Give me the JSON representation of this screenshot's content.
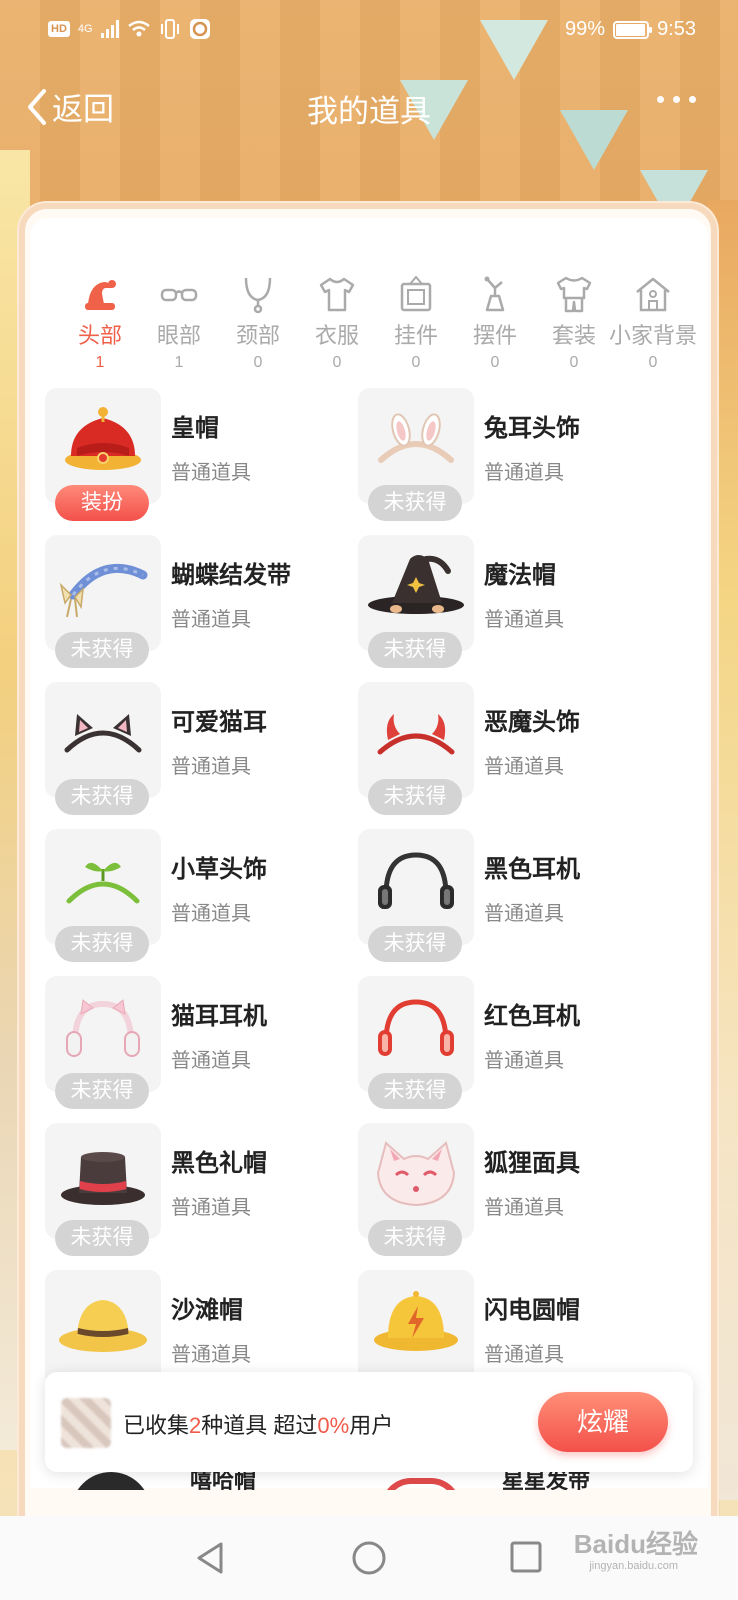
{
  "status_bar": {
    "hd": "HD",
    "network": "4G",
    "battery": "99%",
    "time": "9:53"
  },
  "nav": {
    "back_label": "返回",
    "title": "我的道具"
  },
  "tabs": [
    {
      "icon": "hat-icon",
      "label": "头部",
      "count": "1"
    },
    {
      "icon": "glasses-icon",
      "label": "眼部",
      "count": "1"
    },
    {
      "icon": "necklace-icon",
      "label": "颈部",
      "count": "0"
    },
    {
      "icon": "tshirt-icon",
      "label": "衣服",
      "count": "0"
    },
    {
      "icon": "frame-icon",
      "label": "挂件",
      "count": "0"
    },
    {
      "icon": "ornament-icon",
      "label": "摆件",
      "count": "0"
    },
    {
      "icon": "suit-icon",
      "label": "套装",
      "count": "0"
    },
    {
      "icon": "house-icon",
      "label": "小家背景",
      "count": "0"
    }
  ],
  "items": [
    {
      "name": "皇帽",
      "type": "普通道具",
      "status": "装扮",
      "icon": "crown-hat-icon"
    },
    {
      "name": "兔耳头饰",
      "type": "普通道具",
      "status": "未获得",
      "icon": "bunny-ears-icon"
    },
    {
      "name": "蝴蝶结发带",
      "type": "普通道具",
      "status": "未获得",
      "icon": "bow-headband-icon"
    },
    {
      "name": "魔法帽",
      "type": "普通道具",
      "status": "未获得",
      "icon": "witch-hat-icon"
    },
    {
      "name": "可爱猫耳",
      "type": "普通道具",
      "status": "未获得",
      "icon": "cat-ears-icon"
    },
    {
      "name": "恶魔头饰",
      "type": "普通道具",
      "status": "未获得",
      "icon": "devil-horns-icon"
    },
    {
      "name": "小草头饰",
      "type": "普通道具",
      "status": "未获得",
      "icon": "sprout-headband-icon"
    },
    {
      "name": "黑色耳机",
      "type": "普通道具",
      "status": "未获得",
      "icon": "black-headphones-icon"
    },
    {
      "name": "猫耳耳机",
      "type": "普通道具",
      "status": "未获得",
      "icon": "cat-headphones-icon"
    },
    {
      "name": "红色耳机",
      "type": "普通道具",
      "status": "未获得",
      "icon": "red-headphones-icon"
    },
    {
      "name": "黑色礼帽",
      "type": "普通道具",
      "status": "未获得",
      "icon": "top-hat-icon"
    },
    {
      "name": "狐狸面具",
      "type": "普通道具",
      "status": "未获得",
      "icon": "fox-mask-icon"
    },
    {
      "name": "沙滩帽",
      "type": "普通道具",
      "status": "",
      "icon": "beach-hat-icon"
    },
    {
      "name": "闪电圆帽",
      "type": "普通道具",
      "status": "",
      "icon": "lightning-hat-icon"
    }
  ],
  "peek_items": [
    {
      "name": "嘻哈帽"
    },
    {
      "name": "星星发带"
    }
  ],
  "collect": {
    "prefix": "已收集",
    "count": "2",
    "middle": "种道具 超过",
    "percent": "0%",
    "suffix": "用户",
    "button": "炫耀"
  },
  "watermark": {
    "brand": "Baidu经验",
    "url": "jingyan.baidu.com"
  },
  "colors": {
    "accent": "#f0614a",
    "inactive": "#aaaaaa"
  }
}
